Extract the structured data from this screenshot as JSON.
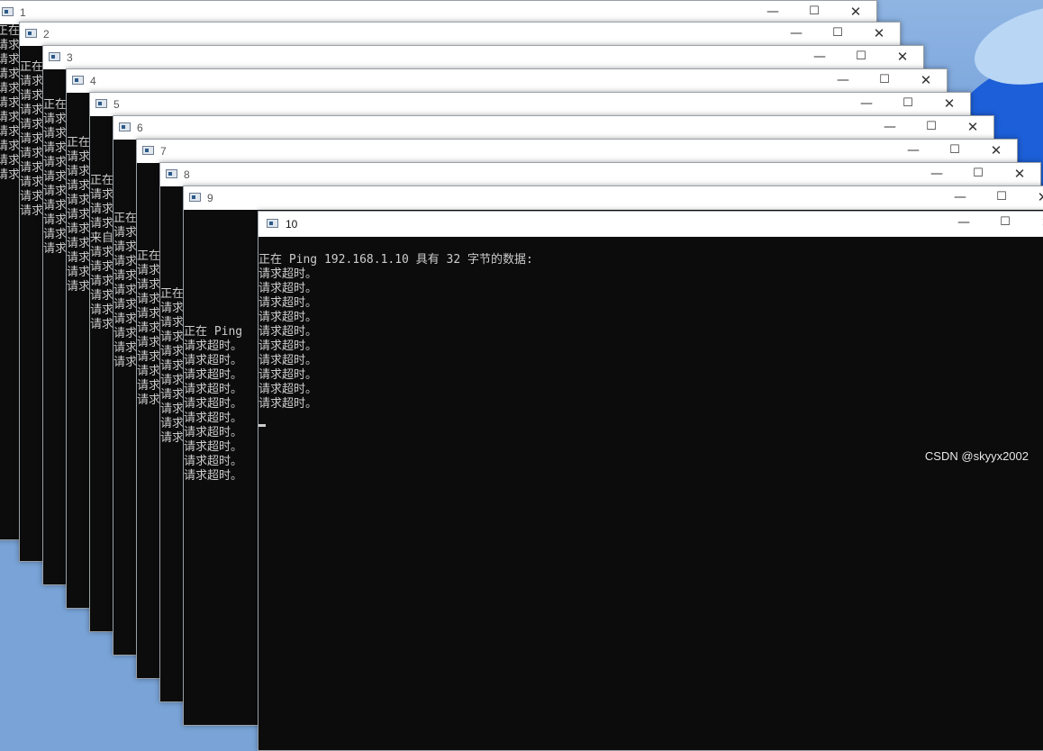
{
  "windows": [
    {
      "title": "1",
      "lines": [
        "正在",
        "请求",
        "请求",
        "请求",
        "请求",
        "请求",
        "请求",
        "请求",
        "请求",
        "请求",
        "请求"
      ]
    },
    {
      "title": "2",
      "lines": [
        "",
        "正在",
        "请求",
        "请求",
        "请求",
        "请求",
        "请求",
        "请求",
        "请求",
        "请求",
        "请求",
        "请求"
      ]
    },
    {
      "title": "3",
      "lines": [
        "",
        "",
        "正在",
        "请求",
        "请求",
        "请求",
        "请求",
        "请求",
        "请求",
        "请求",
        "请求",
        "请求",
        "请求"
      ]
    },
    {
      "title": "4",
      "lines": [
        "",
        "",
        "",
        "正在",
        "请求",
        "请求",
        "请求",
        "请求",
        "请求",
        "请求",
        "请求",
        "请求",
        "请求",
        "请求"
      ]
    },
    {
      "title": "5",
      "lines": [
        "",
        "",
        "",
        "",
        "正在",
        "请求",
        "请求",
        "请求",
        "来自",
        "请求",
        "请求",
        "请求",
        "请求",
        "请求",
        "请求"
      ]
    },
    {
      "title": "6",
      "lines": [
        "",
        "",
        "",
        "",
        "",
        "正在",
        "请求",
        "请求",
        "请求",
        "请求",
        "请求",
        "请求",
        "请求",
        "请求",
        "请求",
        "请求"
      ]
    },
    {
      "title": "7",
      "lines": [
        "",
        "",
        "",
        "",
        "",
        "",
        "正在",
        "请求",
        "请求",
        "请求",
        "请求",
        "请求",
        "请求",
        "请求",
        "请求",
        "请求",
        "请求"
      ]
    },
    {
      "title": "8",
      "lines": [
        "",
        "",
        "",
        "",
        "",
        "",
        "",
        "正在",
        "请求",
        "请求",
        "请求",
        "请求",
        "请求",
        "请求",
        "请求",
        "请求",
        "请求",
        "请求"
      ]
    },
    {
      "title": "9",
      "lines": [
        "",
        "",
        "",
        "",
        "",
        "",
        "",
        "",
        "正在 Ping",
        "请求超时。",
        "请求超时。",
        "请求超时。",
        "请求超时。",
        "请求超时。",
        "请求超时。",
        "请求超时。",
        "请求超时。",
        "请求超时。",
        "请求超时。"
      ]
    },
    {
      "title": "10",
      "lines": [
        "正在 Ping 192.168.1.10 具有 32 字节的数据:",
        "请求超时。",
        "请求超时。",
        "请求超时。",
        "请求超时。",
        "请求超时。",
        "请求超时。",
        "请求超时。",
        "请求超时。",
        "请求超时。",
        "请求超时。"
      ]
    }
  ],
  "controls": {
    "minimize": "—",
    "maximize": "☐",
    "close": "✕"
  },
  "watermark": "CSDN @skyyx2002"
}
